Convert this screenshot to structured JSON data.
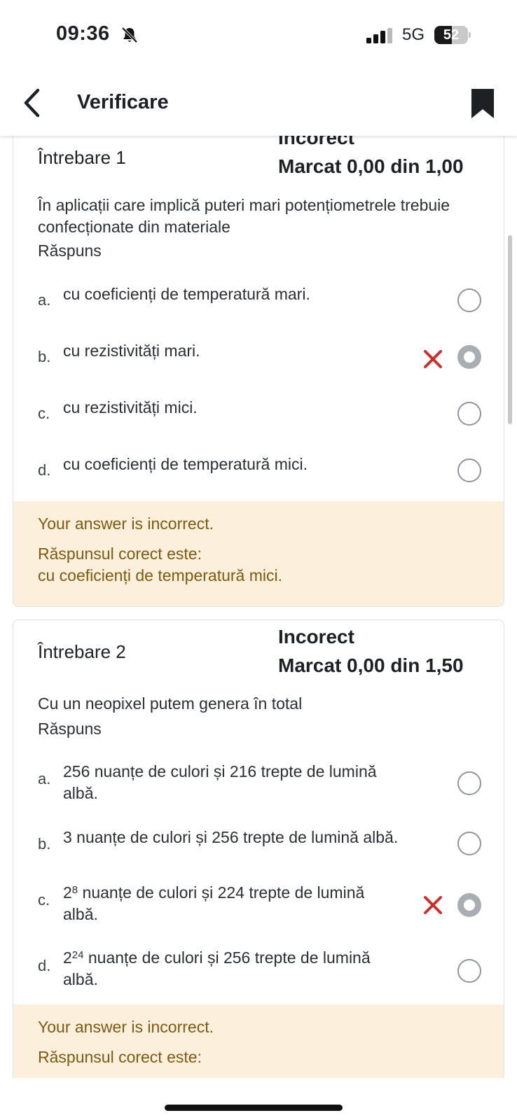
{
  "status_bar": {
    "time": "09:36",
    "network": "5G",
    "battery_level": "52",
    "battery_fill_fraction": 0.52,
    "icons": [
      "bell-slash-icon",
      "cellular-signal-icon",
      "battery-icon"
    ]
  },
  "header": {
    "title": "Verificare",
    "icons": [
      "back-chevron-icon",
      "bookmark-icon"
    ]
  },
  "questions": [
    {
      "label": "Întrebare 1",
      "state": "Incorect",
      "grade": "Marcat 0,00 din 1,00",
      "text": "În aplicații care implică puteri mari potențiometrele trebuie confecționate din materiale",
      "answer_label": "Răspuns",
      "options": [
        {
          "letter": "a.",
          "text": "cu coeficienți de temperatură mari.",
          "selected": false,
          "marked_wrong": false
        },
        {
          "letter": "b.",
          "text": "cu rezistivități mari.",
          "selected": true,
          "marked_wrong": true
        },
        {
          "letter": "c.",
          "text": "cu rezistivități mici.",
          "selected": false,
          "marked_wrong": false
        },
        {
          "letter": "d.",
          "text": "cu coeficienți de temperatură mici.",
          "selected": false,
          "marked_wrong": false
        }
      ],
      "feedback": {
        "result": "Your answer is incorrect.",
        "correct_label": "Răspunsul corect este:",
        "correct_answer": "cu coeficienți de temperatură mici."
      }
    },
    {
      "label": "Întrebare 2",
      "state": "Incorect",
      "grade": "Marcat 0,00 din 1,50",
      "text": "Cu un neopixel putem genera în total",
      "answer_label": "Răspuns",
      "options": [
        {
          "letter": "a.",
          "text_line1": "256 nuanțe de culori și 216 trepte de lumină",
          "text_line2": "albă.",
          "selected": false,
          "marked_wrong": false
        },
        {
          "letter": "b.",
          "text_line1": "3 nuanțe de culori și 256 trepte de lumină albă.",
          "selected": false,
          "marked_wrong": false
        },
        {
          "letter": "c.",
          "base": "2",
          "exponent": "8",
          "text_line1_rest": " nuanțe de culori și 224 trepte de lumină",
          "text_line2": "albă.",
          "selected": true,
          "marked_wrong": true
        },
        {
          "letter": "d.",
          "base": "2",
          "exponent": "24",
          "text_line1_rest": " nuanțe de culori și 256 trepte de lumină",
          "text_line2": "albă.",
          "selected": false,
          "marked_wrong": false
        }
      ],
      "feedback": {
        "result": "Your answer is incorrect.",
        "correct_label": "Răspunsul corect este:"
      }
    }
  ],
  "colors": {
    "wrong_mark": "#c9302c",
    "feedback_background": "#fcefdc",
    "feedback_text": "#7d5a12"
  }
}
